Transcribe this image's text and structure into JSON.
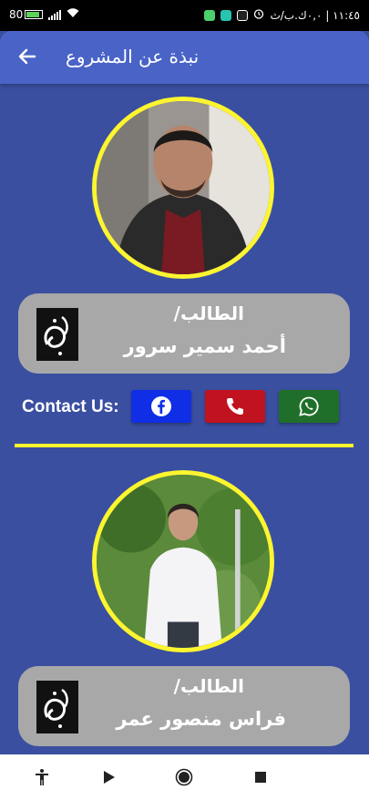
{
  "status_bar": {
    "time": "١١:٤٥ | ٠,٠ك.ب/ث",
    "battery": "80"
  },
  "app_bar": {
    "title": "نبذة عن المشروع",
    "back_icon": "arrow-left-icon"
  },
  "students": [
    {
      "label": "الطالب/",
      "name": "أحمد سمير سرور"
    },
    {
      "label": "الطالب/",
      "name": "فراس منصور عمر"
    }
  ],
  "contact": {
    "label": "Contact Us:",
    "buttons": [
      {
        "icon": "facebook-icon",
        "color": "#0f2ee6"
      },
      {
        "icon": "phone-icon",
        "color": "#c1121f"
      },
      {
        "icon": "whatsapp-icon",
        "color": "#1f6f2a"
      }
    ]
  },
  "colors": {
    "background": "#3a4fa0",
    "app_bar": "#4a63c7",
    "accent_yellow": "#fcf52f",
    "card": "#a8a8a8"
  },
  "nav_bar": {
    "icons": [
      "accessibility-icon",
      "back-triangle-icon",
      "home-circle-icon",
      "recents-square-icon"
    ]
  }
}
